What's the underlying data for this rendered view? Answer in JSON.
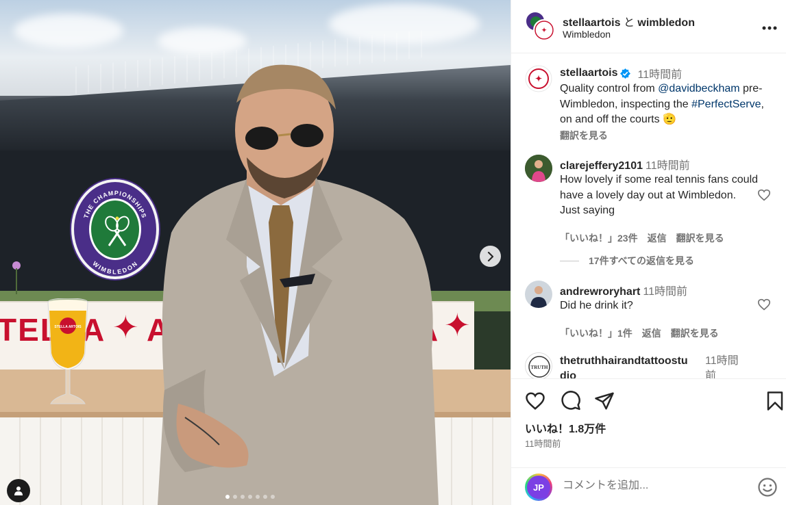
{
  "header": {
    "account1": "stellaartois",
    "connector": "と",
    "account2": "wimbledon",
    "location": "Wimbledon",
    "more_icon": "more-horizontal-icon"
  },
  "caption": {
    "username": "stellaartois",
    "verified_icon": "verified-badge-icon",
    "time": "11時間前",
    "text_1": "Quality control from ",
    "mention": "@davidbeckham",
    "text_2": " pre-Wimbledon, inspecting the ",
    "hashtag": "#PerfectServe",
    "text_3": ", on and off the courts ",
    "emoji": "🫡",
    "see_translation": "翻訳を見る"
  },
  "comments": [
    {
      "username": "clarejeffery2101",
      "time": "11時間前",
      "text": "How lovely if some real tennis fans could have a lovely day out at Wimbledon. Just saying",
      "likes": "「いいね！」23件",
      "reply": "返信",
      "translate": "翻訳を見る",
      "view_replies": "17件すべての返信を見る"
    },
    {
      "username": "andrewroryhart",
      "time": "11時間前",
      "text": "Did he drink it?",
      "likes": "「いいね！」1件",
      "reply": "返信",
      "translate": "翻訳を見る"
    },
    {
      "username": "thetruthhairandtattoostudio",
      "username_line1": "thetruthhairandtattoostu",
      "username_line2": "dio",
      "time_line1": "11時間",
      "time_line2": "前"
    }
  ],
  "photo": {
    "counter_left": "TELLA",
    "counter_right": "A",
    "counter_end": "A",
    "wimbledon_logo_top": "THE CHAMPIONSHIPS",
    "wimbledon_logo_bottom": "WIMBLEDON",
    "glass_label": "STELLA ARTOIS",
    "carousel_total": 7,
    "carousel_active": 1,
    "next_icon": "chevron-right-icon",
    "tag_icon": "user-tag-icon"
  },
  "actions": {
    "like_icon": "heart-icon",
    "comment_icon": "comment-icon",
    "share_icon": "send-icon",
    "save_icon": "bookmark-icon",
    "likes_count": "いいね！1.8万件",
    "post_time": "11時間前"
  },
  "add_comment": {
    "avatar_text": "JP",
    "placeholder": "コメントを追加...",
    "emoji_icon": "emoji-icon"
  },
  "colors": {
    "stella_red": "#c8102e",
    "wimbledon_purple": "#4a2e88",
    "wimbledon_green": "#1f7a3a",
    "link_blue": "#00376b",
    "verified_blue": "#0095f6",
    "muted_text": "#737373"
  }
}
